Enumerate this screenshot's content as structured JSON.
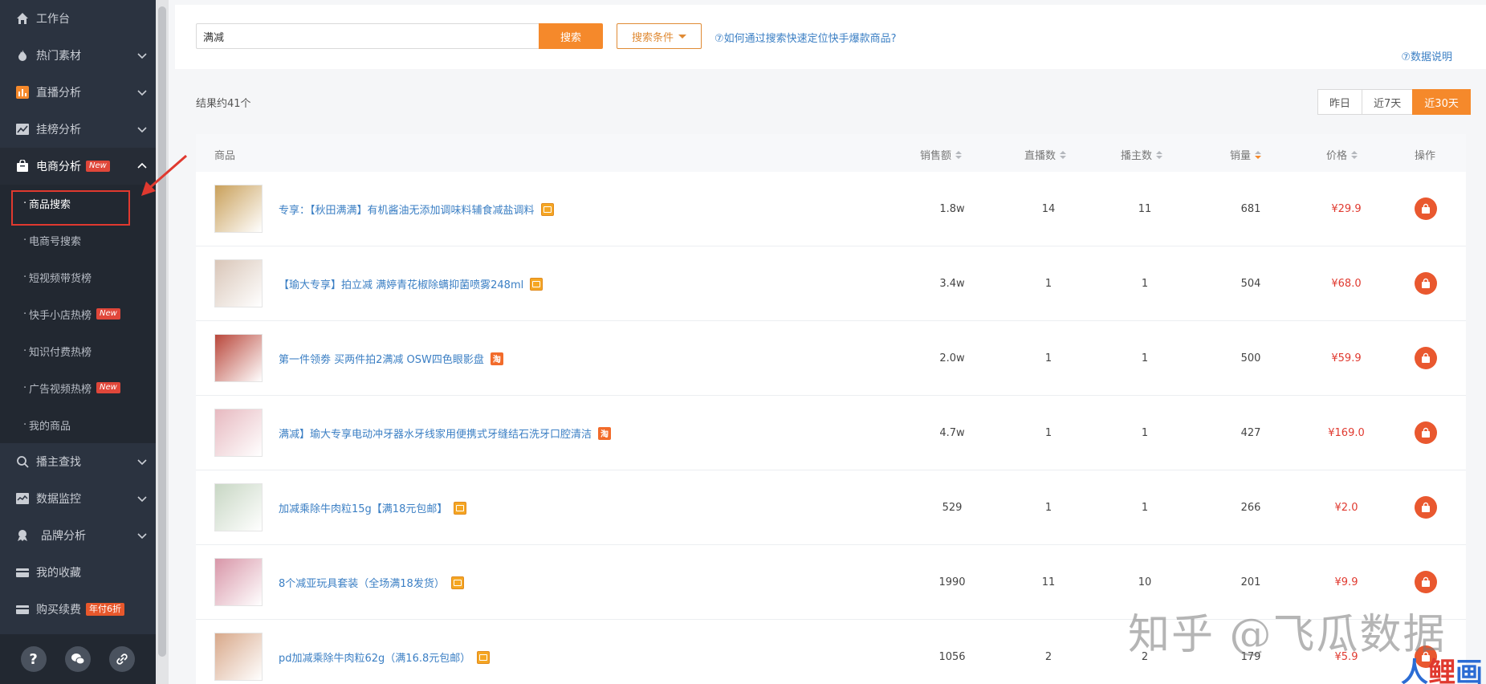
{
  "sidebar": {
    "items": [
      {
        "label": "工作台",
        "icon": "home-icon"
      },
      {
        "label": "热门素材",
        "icon": "fire-icon"
      },
      {
        "label": "直播分析",
        "icon": "bar-chart-icon"
      },
      {
        "label": "挂榜分析",
        "icon": "trend-icon"
      },
      {
        "label": "电商分析",
        "icon": "bag-icon",
        "badge": "New"
      }
    ],
    "sub_items": [
      {
        "label": "商品搜索"
      },
      {
        "label": "电商号搜索"
      },
      {
        "label": "短视频带货榜"
      },
      {
        "label": "快手小店热榜",
        "badge": "New"
      },
      {
        "label": "知识付费热榜"
      },
      {
        "label": "广告视频热榜",
        "badge": "New"
      },
      {
        "label": "我的商品"
      }
    ],
    "items_after": [
      {
        "label": "播主查找",
        "icon": "search-icon"
      },
      {
        "label": "数据监控",
        "icon": "monitor-icon"
      },
      {
        "label": "品牌分析",
        "icon": "award-icon"
      },
      {
        "label": "我的收藏",
        "icon": "collection-icon"
      },
      {
        "label": "购买续费",
        "icon": "card-icon",
        "badge": "年付6折"
      }
    ],
    "footer": {
      "help": "?"
    }
  },
  "search": {
    "value": "满减",
    "button": "搜索",
    "conditions": "搜索条件",
    "help_link": "⑦如何通过搜索快速定位快手爆款商品?",
    "data_note": "⑦数据说明"
  },
  "results": {
    "count_text": "结果约41个",
    "ranges": [
      "昨日",
      "近7天",
      "近30天"
    ],
    "active_range": "近30天"
  },
  "table": {
    "headers": {
      "product": "商品",
      "sales_amount": "销售额",
      "live_count": "直播数",
      "host_count": "播主数",
      "sales_volume": "销量",
      "price": "价格",
      "action": "操作"
    },
    "rows": [
      {
        "name": "专享：【秋田满满】有机酱油无添加调味料辅食减盐调料",
        "tag": "ks",
        "sales_amount": "1.8w",
        "live": "14",
        "hosts": "11",
        "volume": "681",
        "price": "¥29.9",
        "thumb_color": "#c9a05a"
      },
      {
        "name": "【瑜大专享】拍立减 满婷青花椒除螨抑菌喷雾248ml",
        "tag": "ks",
        "sales_amount": "3.4w",
        "live": "1",
        "hosts": "1",
        "volume": "504",
        "price": "¥68.0",
        "thumb_color": "#d9c6b8"
      },
      {
        "name": "第一件领劵 买两件拍2满减 OSW四色眼影盘",
        "tag": "tb",
        "tag_text": "淘",
        "sales_amount": "2.0w",
        "live": "1",
        "hosts": "1",
        "volume": "500",
        "price": "¥59.9",
        "thumb_color": "#b9473b"
      },
      {
        "name": "满减】瑜大专享电动冲牙器水牙线家用便携式牙缝结石洗牙口腔清洁",
        "tag": "tb",
        "tag_text": "淘",
        "sales_amount": "4.7w",
        "live": "1",
        "hosts": "1",
        "volume": "427",
        "price": "¥169.0",
        "thumb_color": "#e7b9c0"
      },
      {
        "name": "加减乘除牛肉粒15g【满18元包邮】",
        "tag": "ks",
        "sales_amount": "529",
        "live": "1",
        "hosts": "1",
        "volume": "266",
        "price": "¥2.0",
        "thumb_color": "#c8d7c4"
      },
      {
        "name": "8个减亚玩具套装（全场满18发货）",
        "tag": "ks",
        "sales_amount": "1990",
        "live": "11",
        "hosts": "10",
        "volume": "201",
        "price": "¥9.9",
        "thumb_color": "#d896a8"
      },
      {
        "name": "pd加减乘除牛肉粒62g（满16.8元包邮）",
        "tag": "ks",
        "sales_amount": "1056",
        "live": "2",
        "hosts": "2",
        "volume": "179",
        "price": "¥5.9",
        "thumb_color": "#d8a88a"
      }
    ]
  },
  "watermark": {
    "text": "知乎 @飞瓜数据",
    "logo_a": "人",
    "logo_b": "鲤",
    "logo_c": "画"
  },
  "colors": {
    "accent": "#f5892b",
    "sidebar_bg": "#2b3340",
    "link": "#3b7fc4",
    "price": "#e0392f",
    "highlight": "#e0392f"
  }
}
